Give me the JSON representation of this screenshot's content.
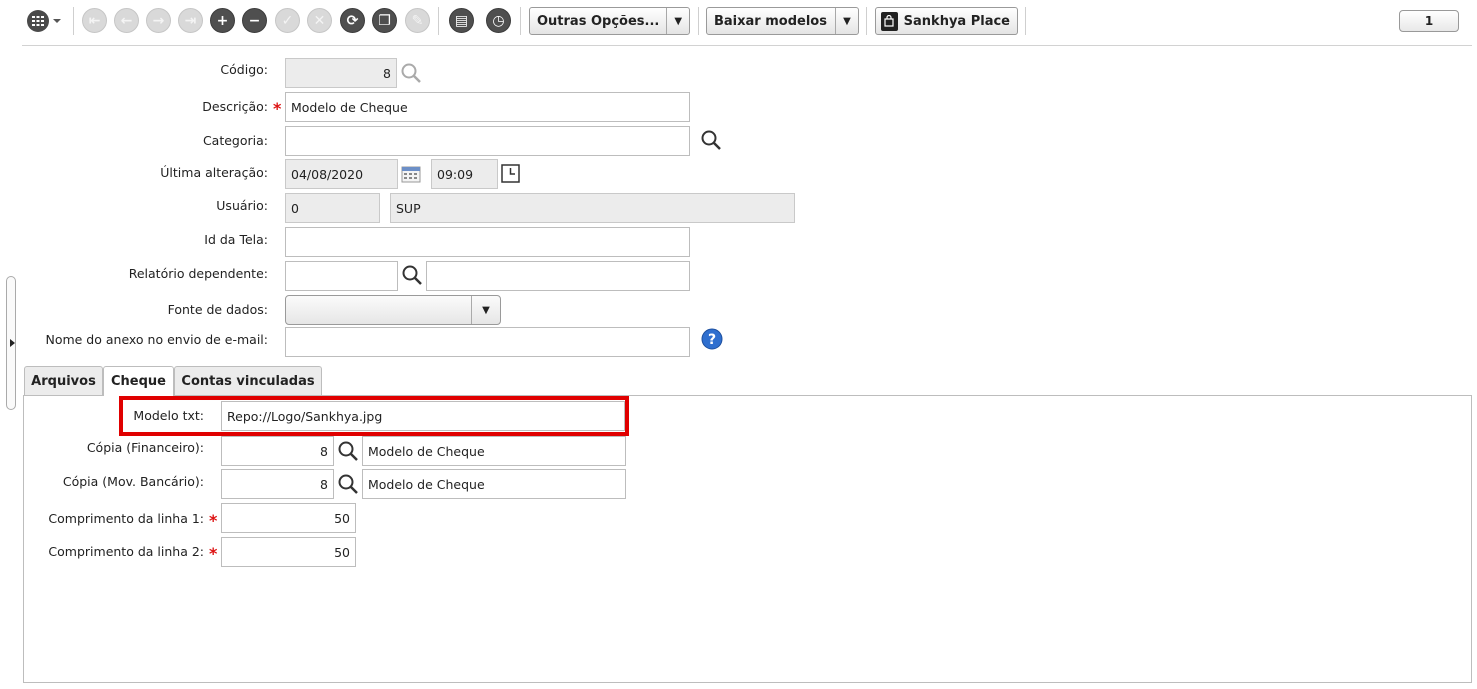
{
  "toolbar": {
    "more_options_label": "Outras Opções...",
    "download_models_label": "Baixar modelos",
    "place_label": "Sankhya Place",
    "record_counter": "1"
  },
  "form": {
    "codigo": {
      "label": "Código:",
      "value": "8"
    },
    "descricao": {
      "label": "Descrição:",
      "value": "Modelo de Cheque"
    },
    "categoria": {
      "label": "Categoria:",
      "value": ""
    },
    "ultima_alteracao": {
      "label": "Última alteração:",
      "date": "04/08/2020",
      "time": "09:09"
    },
    "usuario": {
      "label": "Usuário:",
      "code": "0",
      "name": "SUP"
    },
    "id_tela": {
      "label": "Id da Tela:",
      "value": ""
    },
    "relatorio_dependente": {
      "label": "Relatório dependente:",
      "code": "",
      "name": ""
    },
    "fonte_dados": {
      "label": "Fonte de dados:",
      "value": ""
    },
    "nome_anexo": {
      "label": "Nome do anexo no envio de e-mail:",
      "value": ""
    }
  },
  "tabs": [
    {
      "label": "Arquivos",
      "active": false
    },
    {
      "label": "Cheque",
      "active": true
    },
    {
      "label": "Contas vinculadas",
      "active": false
    }
  ],
  "cheque": {
    "modelo_txt": {
      "label": "Modelo txt:",
      "value": "Repo://Logo/Sankhya.jpg"
    },
    "copia_financeiro": {
      "label": "Cópia (Financeiro):",
      "code": "8",
      "name": "Modelo de Cheque"
    },
    "copia_mov_bancario": {
      "label": "Cópia (Mov. Bancário):",
      "code": "8",
      "name": "Modelo de Cheque"
    },
    "comprimento_linha1": {
      "label": "Comprimento da linha 1:",
      "value": "50"
    },
    "comprimento_linha2": {
      "label": "Comprimento da linha 2:",
      "value": "50"
    }
  },
  "colors": {
    "highlight": "#e00000",
    "help_icon": "#2f6fcf"
  }
}
